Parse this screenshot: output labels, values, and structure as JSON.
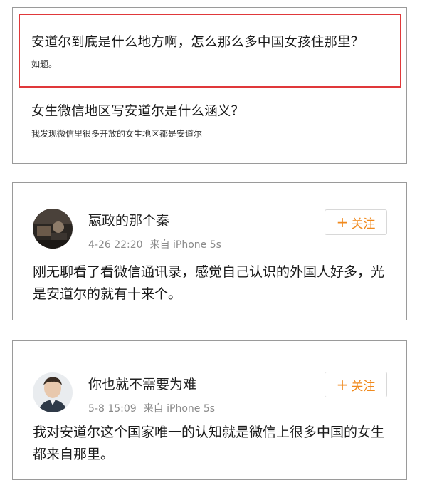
{
  "questions": [
    {
      "title": "安道尔到底是什么地方啊，怎么那么多中国女孩住那里？",
      "description": "如题。"
    },
    {
      "title": "女生微信地区写安道尔是什么涵义？",
      "description": "我发现微信里很多开放的女生地区都是安道尔"
    }
  ],
  "posts": [
    {
      "username": "嬴政的那个秦",
      "time": "4-26 22:20",
      "source": "来自 iPhone 5s",
      "follow_label": "关注",
      "follow_plus": "+",
      "text": "刚无聊看了看微信通讯录，感觉自己认识的外国人好多，光是安道尔的就有十来个。"
    },
    {
      "username": "你也就不需要为难",
      "time": "5-8 15:09",
      "source": "来自 iPhone 5s",
      "follow_label": "关注",
      "follow_plus": "+",
      "text": "我对安道尔这个国家唯一的认知就是微信上很多中国的女生都来自那里。"
    }
  ],
  "colors": {
    "highlight_border": "#e0383a",
    "follow_accent": "#f08a1e",
    "meta_gray": "#8a8a8a"
  }
}
